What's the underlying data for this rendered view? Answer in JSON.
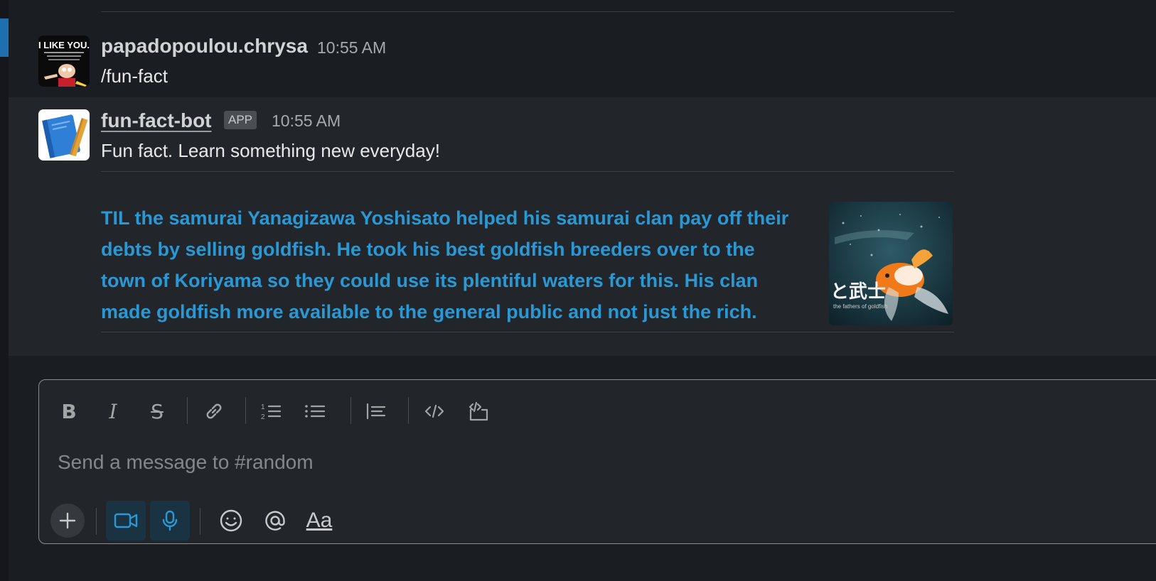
{
  "channel": "random",
  "messages": [
    {
      "author": "papadopoulou.chrysa",
      "time": "10:55 AM",
      "text": "/fun-fact",
      "avatar_caption": "I LIKE YOU."
    },
    {
      "author": "fun-fact-bot",
      "badge": "APP",
      "time": "10:55 AM",
      "text": "Fun fact. Learn something new everyday!",
      "attachment": {
        "text": "TIL the samurai Yanagizawa Yoshisato helped his samurai clan pay off their debts by selling goldfish. He took his best goldfish breeders over to the town of Koriyama so they could use its plentiful waters for this. His clan made goldfish more available to the general public and not just the rich.",
        "thumbnail_caption": "と武士",
        "thumbnail_subcaption": "the fathers of goldfish"
      }
    }
  ],
  "composer": {
    "placeholder": "Send a message to #random",
    "value": "",
    "format_label": "Aa",
    "toolbar_icons": [
      "bold-icon",
      "italic-icon",
      "strikethrough-icon",
      "link-icon",
      "ordered-list-icon",
      "bulleted-list-icon",
      "blockquote-icon",
      "code-icon",
      "code-block-icon"
    ],
    "bottom_icons": [
      "plus-icon",
      "video-icon",
      "microphone-icon",
      "emoji-icon",
      "mention-icon"
    ]
  },
  "colors": {
    "background": "#1a1d21",
    "highlight_row": "#222529",
    "link_blue": "#2a98d4",
    "unread_marker": "#1d6fb0"
  }
}
